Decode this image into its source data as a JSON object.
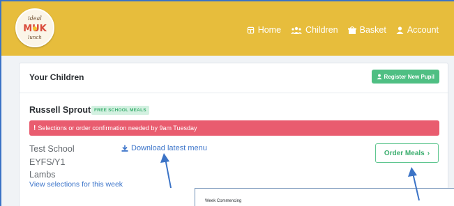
{
  "logo": {
    "text_top": "ideal",
    "text_middle": "MUK",
    "text_bottom": "lunch"
  },
  "nav": {
    "items": [
      {
        "label": "Home",
        "icon": "home-icon"
      },
      {
        "label": "Children",
        "icon": "children-icon"
      },
      {
        "label": "Basket",
        "icon": "basket-icon"
      },
      {
        "label": "Account",
        "icon": "account-icon"
      }
    ]
  },
  "card": {
    "title": "Your Children",
    "register_label": "Register New Pupil"
  },
  "child": {
    "name": "Russell Sprout",
    "badge": "FREE SCHOOL MEALS",
    "alert": "Selections or order confirmation needed by 9am Tuesday",
    "school": "Test School",
    "year": "EYFS/Y1",
    "class": "Lambs",
    "view_link": "View selections for this week",
    "download_link": "Download latest menu",
    "order_label": "Order Meals"
  },
  "overlay": {
    "label": "Week Commencing"
  },
  "colors": {
    "header": "#e7bd3c",
    "green": "#4fbf83",
    "alert": "#e95c6f",
    "link": "#3a73c9",
    "annotation": "#3b73c6"
  }
}
